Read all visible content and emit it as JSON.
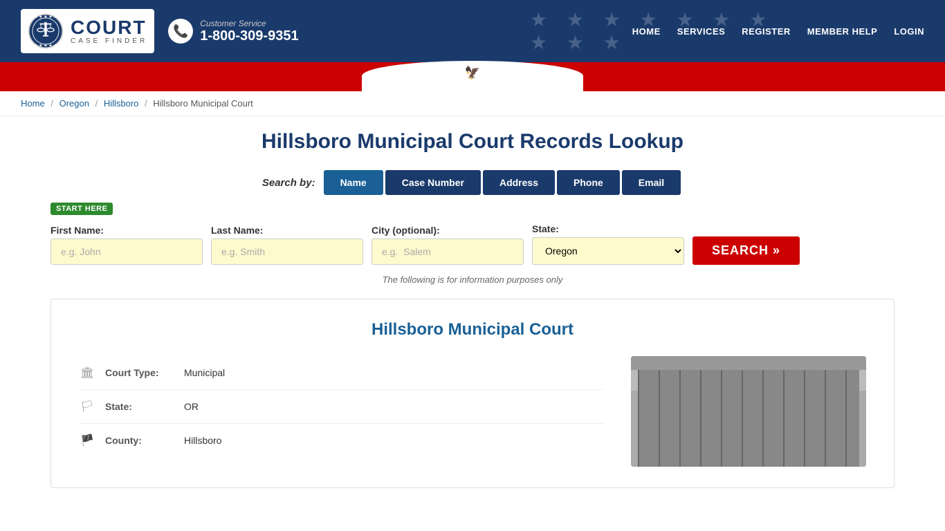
{
  "site": {
    "name": "COURT",
    "subtitle": "CASE FINDER"
  },
  "header": {
    "customer_service_label": "Customer Service",
    "phone": "1-800-309-9351",
    "nav": [
      {
        "label": "HOME",
        "id": "home"
      },
      {
        "label": "SERVICES",
        "id": "services"
      },
      {
        "label": "REGISTER",
        "id": "register"
      },
      {
        "label": "MEMBER HELP",
        "id": "member-help"
      },
      {
        "label": "LOGIN",
        "id": "login"
      }
    ]
  },
  "breadcrumb": {
    "items": [
      {
        "label": "Home",
        "id": "home"
      },
      {
        "label": "Oregon",
        "id": "oregon"
      },
      {
        "label": "Hillsboro",
        "id": "hillsboro"
      }
    ],
    "current": "Hillsboro Municipal Court"
  },
  "page": {
    "title": "Hillsboro Municipal Court Records Lookup"
  },
  "search": {
    "by_label": "Search by:",
    "tabs": [
      {
        "label": "Name",
        "active": true
      },
      {
        "label": "Case Number",
        "active": false
      },
      {
        "label": "Address",
        "active": false
      },
      {
        "label": "Phone",
        "active": false
      },
      {
        "label": "Email",
        "active": false
      }
    ],
    "start_here": "START HERE",
    "fields": {
      "first_name_label": "First Name:",
      "first_name_placeholder": "e.g. John",
      "last_name_label": "Last Name:",
      "last_name_placeholder": "e.g. Smith",
      "city_label": "City (optional):",
      "city_placeholder": "e.g.  Salem",
      "state_label": "State:",
      "state_default": "Oregon"
    },
    "button_label": "SEARCH »",
    "disclaimer": "The following is for information purposes only"
  },
  "court_info": {
    "name": "Hillsboro Municipal Court",
    "rows": [
      {
        "icon": "building-icon",
        "label": "Court Type:",
        "value": "Municipal"
      },
      {
        "icon": "flag-icon",
        "label": "State:",
        "value": "OR"
      },
      {
        "icon": "location-icon",
        "label": "County:",
        "value": "Hillsboro"
      }
    ]
  }
}
